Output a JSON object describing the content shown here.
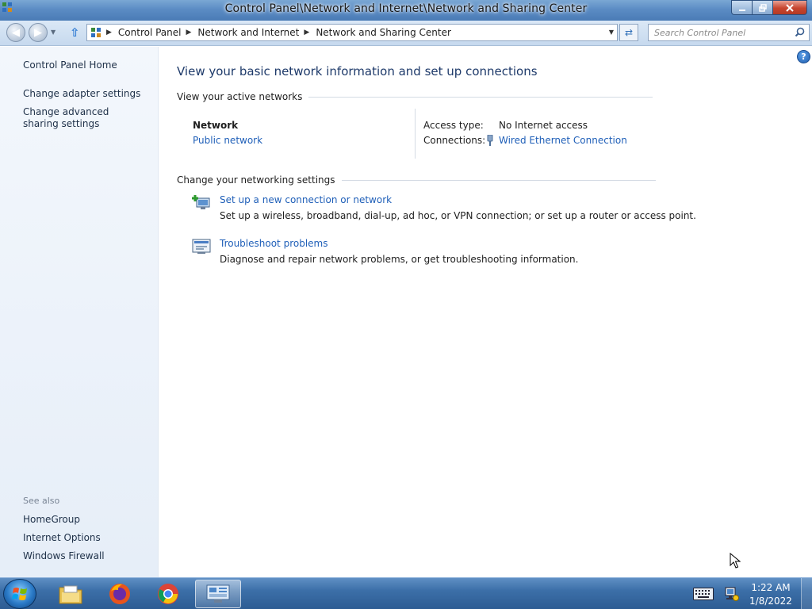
{
  "window": {
    "title": "Control Panel\\Network and Internet\\Network and Sharing Center"
  },
  "address": {
    "crumbs": [
      "Control Panel",
      "Network and Internet",
      "Network and Sharing Center"
    ]
  },
  "search": {
    "placeholder": "Search Control Panel"
  },
  "sidebar": {
    "home": "Control Panel Home",
    "items": [
      "Change adapter settings",
      "Change advanced sharing settings"
    ],
    "see_also_label": "See also",
    "see_also": [
      "HomeGroup",
      "Internet Options",
      "Windows Firewall"
    ]
  },
  "main": {
    "title": "View your basic network information and set up connections",
    "active_networks_heading": "View your active networks",
    "network": {
      "name": "Network",
      "type": "Public network",
      "access_label": "Access type:",
      "access_value": "No Internet access",
      "connections_label": "Connections:",
      "connection_value": "Wired Ethernet Connection"
    },
    "settings_heading": "Change your networking settings",
    "tasks": [
      {
        "link": "Set up a new connection or network",
        "desc": "Set up a wireless, broadband, dial-up, ad hoc, or VPN connection; or set up a router or access point.",
        "icon": "new-connection-icon"
      },
      {
        "link": "Troubleshoot problems",
        "desc": "Diagnose and repair network problems, or get troubleshooting information.",
        "icon": "troubleshoot-icon"
      }
    ]
  },
  "taskbar": {
    "clock_time": "1:22 AM",
    "clock_date": "1/8/2022",
    "apps": [
      "file-explorer-icon",
      "firefox-icon",
      "chrome-icon",
      "control-panel-icon"
    ]
  },
  "colors": {
    "link": "#1f5fb8",
    "title": "#1e3a6a",
    "taskbar": "#3c6fa8"
  }
}
